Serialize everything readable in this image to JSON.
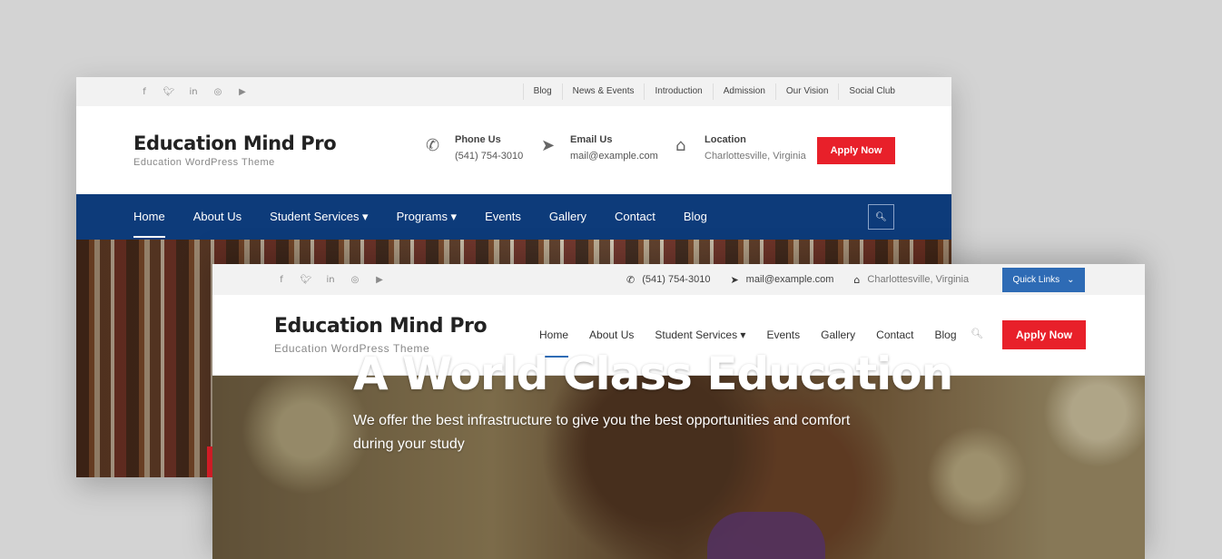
{
  "back_screen": {
    "social_icons": [
      "f",
      "t",
      "in",
      "ig",
      "yt"
    ],
    "top_links": [
      "Blog",
      "News & Events",
      "Introduction",
      "Admission",
      "Our Vision",
      "Social Club"
    ],
    "site_title": "Education Mind Pro",
    "tagline": "Education WordPress Theme",
    "phone": {
      "label": "Phone Us",
      "value": "(541) 754-3010"
    },
    "email": {
      "label": "Email Us",
      "value": "mail@example.com"
    },
    "location": {
      "label": "Location",
      "value": "Charlottesville, Virginia"
    },
    "apply_label": "Apply Now",
    "nav": [
      "Home",
      "About Us",
      "Student Services ▾",
      "Programs ▾",
      "Events",
      "Gallery",
      "Contact",
      "Blog"
    ],
    "active_nav": "Home"
  },
  "front_screen": {
    "social_icons": [
      "f",
      "t",
      "in",
      "ig",
      "yt"
    ],
    "phone": "(541) 754-3010",
    "email": "mail@example.com",
    "location": "Charlottesville, Virginia",
    "quick_links_label": "Quick Links",
    "site_title": "Education Mind Pro",
    "tagline": "Education WordPress Theme",
    "nav": [
      "Home",
      "About Us",
      "Student Services ▾",
      "Events",
      "Gallery",
      "Contact",
      "Blog"
    ],
    "active_nav": "Home",
    "apply_label": "Apply Now",
    "hero_title": "A World Class Education",
    "hero_subtitle": "We offer the best infrastructure to give you the best opportunities and comfort during your study"
  },
  "colors": {
    "navy": "#0d3b7a",
    "red": "#e8202a",
    "blue": "#2e6bb5",
    "page_bg": "#d3d3d3"
  },
  "icons": {
    "phone": "phone-icon",
    "email": "paper-plane-icon",
    "location": "home-icon",
    "search": "search-icon"
  }
}
